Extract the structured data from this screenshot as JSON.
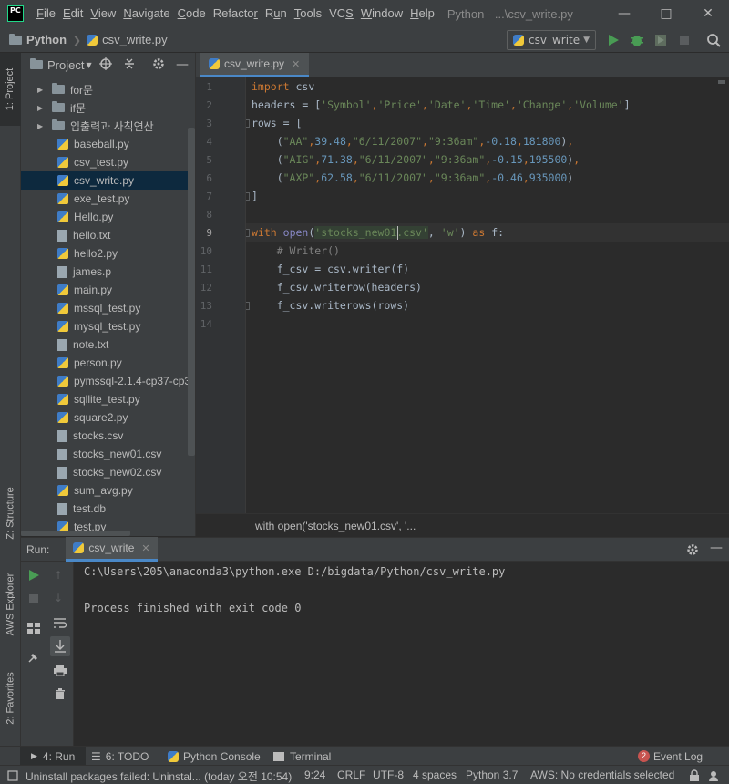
{
  "app": {
    "logo": "PC",
    "window_title": "Python - ...\\csv_write.py"
  },
  "menu": [
    {
      "pre": "",
      "u": "F",
      "post": "ile"
    },
    {
      "pre": "",
      "u": "E",
      "post": "dit"
    },
    {
      "pre": "",
      "u": "V",
      "post": "iew"
    },
    {
      "pre": "",
      "u": "N",
      "post": "avigate"
    },
    {
      "pre": "",
      "u": "C",
      "post": "ode"
    },
    {
      "pre": "Refacto",
      "u": "r",
      "post": ""
    },
    {
      "pre": "R",
      "u": "u",
      "post": "n"
    },
    {
      "pre": "",
      "u": "T",
      "post": "ools"
    },
    {
      "pre": "VC",
      "u": "S",
      "post": ""
    },
    {
      "pre": "",
      "u": "W",
      "post": "indow"
    },
    {
      "pre": "",
      "u": "H",
      "post": "elp"
    }
  ],
  "breadcrumb": {
    "project": "Python",
    "file": "csv_write.py"
  },
  "run_config": {
    "label": "csv_write"
  },
  "left_stripe": {
    "project": "1: Project",
    "structure": "Z: Structure",
    "aws": "AWS Explorer",
    "favorites": "2: Favorites"
  },
  "project_panel": {
    "title": "Project",
    "items": [
      {
        "type": "folder",
        "name": "for문",
        "expandable": true
      },
      {
        "type": "folder",
        "name": "if문",
        "expandable": true
      },
      {
        "type": "folder",
        "name": "입출력과 사칙연산",
        "expandable": true
      },
      {
        "type": "py",
        "name": "baseball.py"
      },
      {
        "type": "py",
        "name": "csv_test.py"
      },
      {
        "type": "py",
        "name": "csv_write.py",
        "selected": true
      },
      {
        "type": "py",
        "name": "exe_test.py"
      },
      {
        "type": "py",
        "name": "Hello.py"
      },
      {
        "type": "txt",
        "name": "hello.txt"
      },
      {
        "type": "py",
        "name": "hello2.py"
      },
      {
        "type": "unk",
        "name": "james.p"
      },
      {
        "type": "py",
        "name": "main.py"
      },
      {
        "type": "py",
        "name": "mssql_test.py"
      },
      {
        "type": "py",
        "name": "mysql_test.py"
      },
      {
        "type": "txt",
        "name": "note.txt"
      },
      {
        "type": "py",
        "name": "person.py"
      },
      {
        "type": "py",
        "name": "pymssql-2.1.4-cp37-cp3"
      },
      {
        "type": "py",
        "name": "sqllite_test.py"
      },
      {
        "type": "py",
        "name": "square2.py"
      },
      {
        "type": "txt",
        "name": "stocks.csv"
      },
      {
        "type": "txt",
        "name": "stocks_new01.csv"
      },
      {
        "type": "txt",
        "name": "stocks_new02.csv"
      },
      {
        "type": "py",
        "name": "sum_avg.py"
      },
      {
        "type": "txt",
        "name": "test.db"
      },
      {
        "type": "py",
        "name": "test.py"
      }
    ]
  },
  "editor": {
    "tab": "csv_write.py",
    "breadcrumb": "with open('stocks_new01.csv', '...",
    "line_numbers": [
      "1",
      "2",
      "3",
      "4",
      "5",
      "6",
      "7",
      "8",
      "9",
      "10",
      "11",
      "12",
      "13",
      "14"
    ],
    "active_line": 9
  },
  "run_panel": {
    "label": "Run:",
    "tab": "csv_write",
    "output": [
      "C:\\Users\\205\\anaconda3\\python.exe D:/bigdata/Python/csv_write.py",
      "",
      "Process finished with exit code 0"
    ]
  },
  "tool_windows": {
    "run": "4: Run",
    "todo": "6: TODO",
    "python_console": "Python Console",
    "terminal": "Terminal",
    "event_log": "Event Log",
    "event_count": "2"
  },
  "status": {
    "message": "Uninstall packages failed: Uninstal... (today 오전 10:54)",
    "position": "9:24",
    "line_sep": "CRLF",
    "encoding": "UTF-8",
    "indent": "4 spaces",
    "interpreter": "Python 3.7",
    "aws": "AWS: No credentials selected"
  },
  "colors": {
    "accent": "#4a88c7",
    "run_green": "#499c54",
    "selected_row": "#0d293e"
  }
}
